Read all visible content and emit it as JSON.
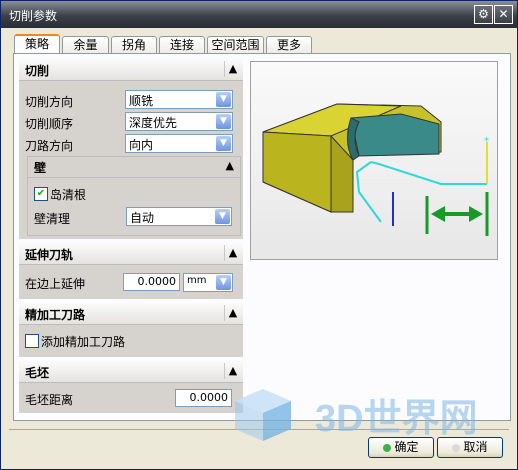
{
  "window": {
    "title": "切削参数"
  },
  "tabs": [
    "策略",
    "余量",
    "拐角",
    "连接",
    "空间范围",
    "更多"
  ],
  "sections": {
    "cutting": {
      "header": "切削",
      "direction_label": "切削方向",
      "direction_value": "顺铣",
      "order_label": "切削顺序",
      "order_value": "深度优先",
      "path_label": "刀路方向",
      "path_value": "向内",
      "wall": {
        "header": "壁",
        "island_label": "岛清根",
        "wall_clean_label": "壁清理",
        "wall_clean_value": "自动"
      }
    },
    "extend": {
      "header": "延伸刀轨",
      "edge_label": "在边上延伸",
      "edge_value": "0.0000",
      "unit": "mm"
    },
    "finish": {
      "header": "精加工刀路",
      "add_label": "添加精加工刀路"
    },
    "blank": {
      "header": "毛坯",
      "distance_label": "毛坯距离",
      "distance_value": "0.0000"
    }
  },
  "buttons": {
    "ok": "确定",
    "cancel": "取消"
  },
  "watermark": {
    "text": "3D世界网"
  },
  "checks": {
    "island": true,
    "finish": false
  }
}
